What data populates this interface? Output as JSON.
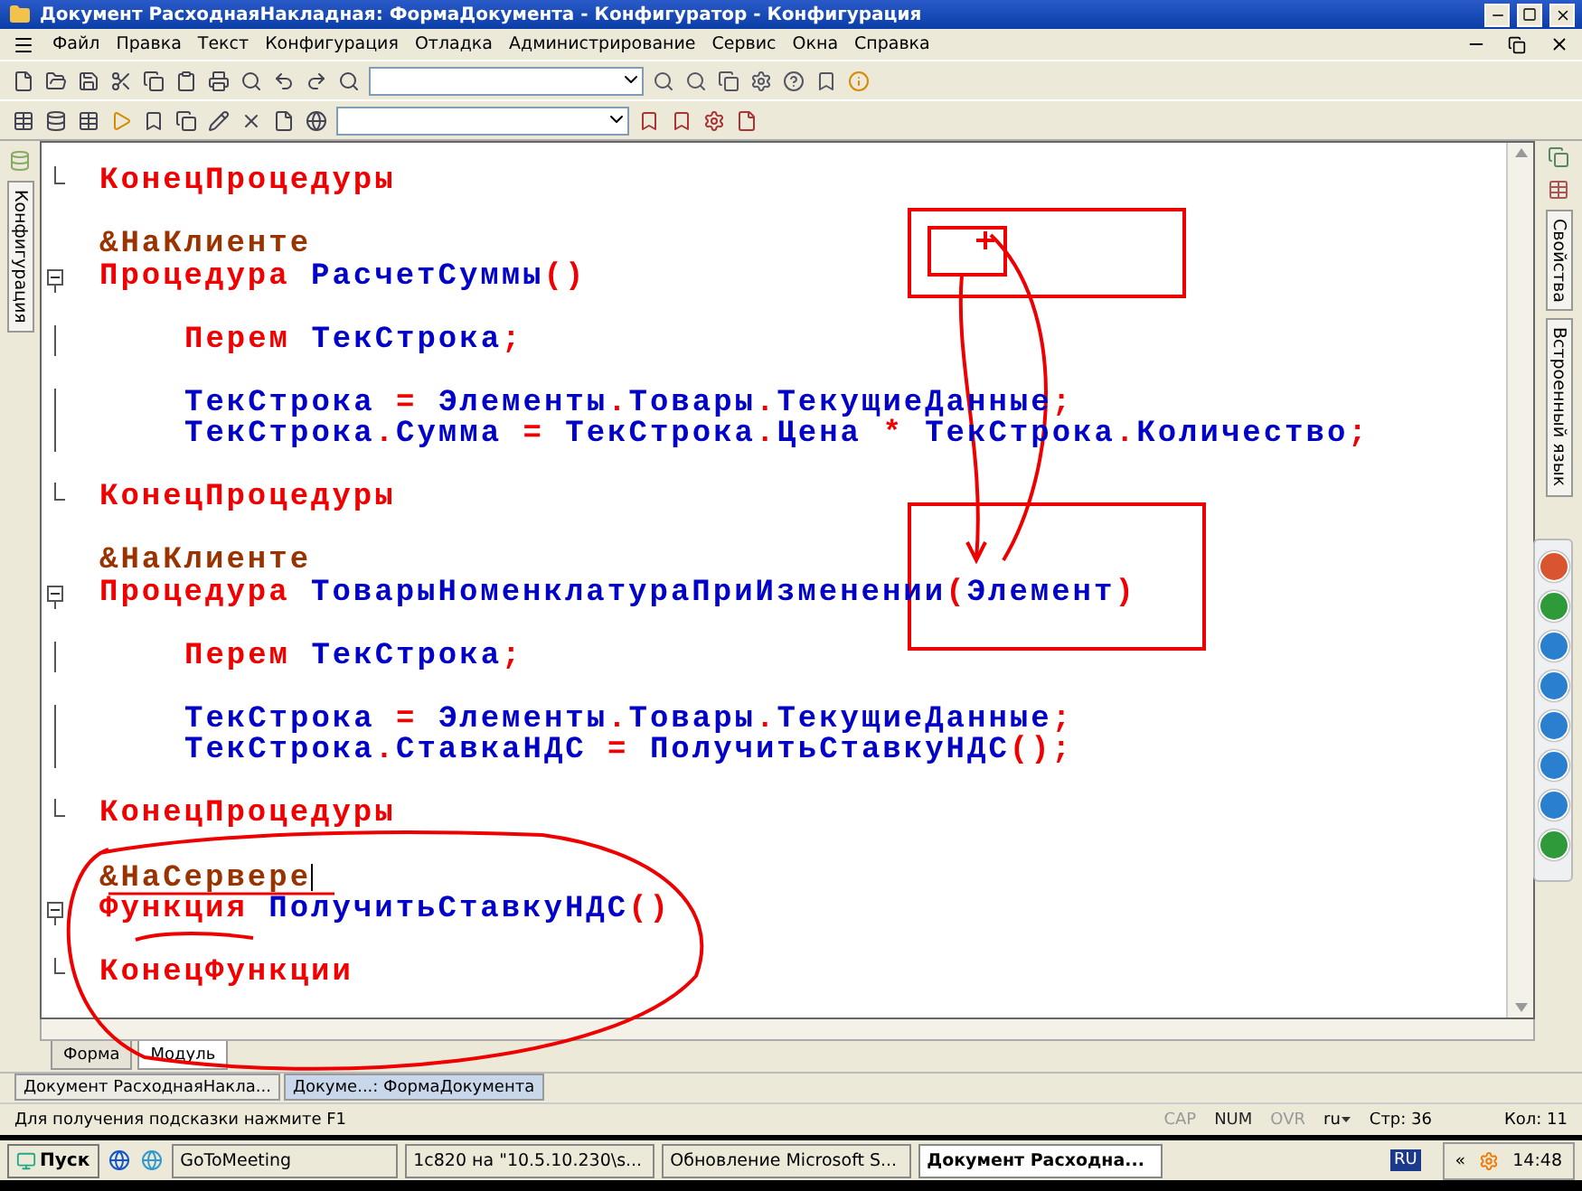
{
  "window": {
    "title": "Документ РасходнаяНакладная: ФормаДокумента - Конфигуратор - Конфигурация"
  },
  "menu": [
    "Файл",
    "Правка",
    "Текст",
    "Конфигурация",
    "Отладка",
    "Администрирование",
    "Сервис",
    "Окна",
    "Справка"
  ],
  "left_panel": {
    "tab": "Конфигурация"
  },
  "right_panel": {
    "tabs": [
      "Свойства",
      "Встроенный язык"
    ]
  },
  "code_lines": [
    {
      "kind": "block_end",
      "tokens": [
        {
          "text": "КонецПроцедуры",
          "kind": "keyword"
        }
      ]
    },
    {
      "kind": "code",
      "space_before": true,
      "tokens": [
        {
          "text": "&НаКлиенте",
          "kind": "directive"
        }
      ]
    },
    {
      "kind": "block_start",
      "tokens": [
        {
          "text": "Процедура ",
          "kind": "keyword"
        },
        {
          "text": "РасчетСуммы",
          "kind": "ident"
        },
        {
          "text": "()",
          "kind": "op"
        }
      ],
      "children": [
        {
          "kind": "code",
          "space_before": true,
          "tokens": [
            {
              "text": "Перем ",
              "kind": "keyword"
            },
            {
              "text": "ТекСтрока",
              "kind": "ident"
            },
            {
              "text": ";",
              "kind": "op"
            }
          ]
        },
        {
          "kind": "code",
          "space_before": true,
          "tokens": [
            {
              "text": "ТекСтрока",
              "kind": "ident"
            },
            {
              "text": " = ",
              "kind": "op"
            },
            {
              "text": "Элементы",
              "kind": "ident"
            },
            {
              "text": ".",
              "kind": "op"
            },
            {
              "text": "Товары",
              "kind": "ident"
            },
            {
              "text": ".",
              "kind": "op"
            },
            {
              "text": "ТекущиеДанные",
              "kind": "ident"
            },
            {
              "text": ";",
              "kind": "op"
            }
          ]
        },
        {
          "kind": "code",
          "tokens": [
            {
              "text": "ТекСтрока",
              "kind": "ident"
            },
            {
              "text": ".",
              "kind": "op"
            },
            {
              "text": "Сумма",
              "kind": "ident"
            },
            {
              "text": " = ",
              "kind": "op"
            },
            {
              "text": "ТекСтрока",
              "kind": "ident"
            },
            {
              "text": ".",
              "kind": "op"
            },
            {
              "text": "Цена",
              "kind": "ident"
            },
            {
              "text": " * ",
              "kind": "op"
            },
            {
              "text": "ТекСтрока",
              "kind": "ident"
            },
            {
              "text": ".",
              "kind": "op"
            },
            {
              "text": "Количество",
              "kind": "ident"
            },
            {
              "text": ";",
              "kind": "op"
            }
          ]
        }
      ]
    },
    {
      "kind": "block_end",
      "space_before": true,
      "tokens": [
        {
          "text": "КонецПроцедуры",
          "kind": "keyword"
        }
      ]
    },
    {
      "kind": "code",
      "space_before": true,
      "tokens": [
        {
          "text": "&НаКлиенте",
          "kind": "directive"
        }
      ]
    },
    {
      "kind": "block_start",
      "tokens": [
        {
          "text": "Процедура ",
          "kind": "keyword"
        },
        {
          "text": "ТоварыНоменклатураПриИзменении",
          "kind": "ident"
        },
        {
          "text": "(",
          "kind": "op"
        },
        {
          "text": "Элемент",
          "kind": "ident"
        },
        {
          "text": ")",
          "kind": "op"
        }
      ],
      "children": [
        {
          "kind": "code",
          "space_before": true,
          "tokens": [
            {
              "text": "Перем ",
              "kind": "keyword"
            },
            {
              "text": "ТекСтрока",
              "kind": "ident"
            },
            {
              "text": ";",
              "kind": "op"
            }
          ]
        },
        {
          "kind": "code",
          "space_before": true,
          "tokens": [
            {
              "text": "ТекСтрока",
              "kind": "ident"
            },
            {
              "text": " = ",
              "kind": "op"
            },
            {
              "text": "Элементы",
              "kind": "ident"
            },
            {
              "text": ".",
              "kind": "op"
            },
            {
              "text": "Товары",
              "kind": "ident"
            },
            {
              "text": ".",
              "kind": "op"
            },
            {
              "text": "ТекущиеДанные",
              "kind": "ident"
            },
            {
              "text": ";",
              "kind": "op"
            }
          ]
        },
        {
          "kind": "code",
          "tokens": [
            {
              "text": "ТекСтрока",
              "kind": "ident"
            },
            {
              "text": ".",
              "kind": "op"
            },
            {
              "text": "СтавкаНДС",
              "kind": "ident"
            },
            {
              "text": " = ",
              "kind": "op"
            },
            {
              "text": "ПолучитьСтавкуНДС",
              "kind": "ident"
            },
            {
              "text": "();",
              "kind": "op"
            }
          ]
        }
      ]
    },
    {
      "kind": "block_end",
      "space_before": true,
      "tokens": [
        {
          "text": "КонецПроцедуры",
          "kind": "keyword"
        }
      ]
    },
    {
      "kind": "code",
      "space_before": true,
      "cursor": true,
      "tokens": [
        {
          "text": "&НаСервере",
          "kind": "directive"
        }
      ]
    },
    {
      "kind": "block_start",
      "tokens": [
        {
          "text": "Функция ",
          "kind": "keyword"
        },
        {
          "text": "ПолучитьСтавкуНДС",
          "kind": "ident"
        },
        {
          "text": "()",
          "kind": "op"
        }
      ]
    },
    {
      "kind": "block_end",
      "space_before": true,
      "tokens": [
        {
          "text": "КонецФункции",
          "kind": "keyword"
        }
      ]
    }
  ],
  "editor_tabs": [
    {
      "label": "Форма",
      "selected": false
    },
    {
      "label": "Модуль",
      "selected": true
    }
  ],
  "window_tabs": [
    {
      "label": "Документ РасходнаяНакла...",
      "selected": false
    },
    {
      "label": "Докуме...: ФормаДокумента",
      "selected": true
    }
  ],
  "status_bar": {
    "hint": "Для получения подсказки нажмите F1",
    "indicators": [
      {
        "label": "CAP",
        "disabled": true
      },
      {
        "label": "NUM",
        "disabled": false
      },
      {
        "label": "OVR",
        "disabled": true
      }
    ],
    "language": "ru",
    "line": "Стр: 36",
    "column": "Кол: 11"
  },
  "taskbar": {
    "start": "Пуск",
    "items": [
      {
        "label": "GoToMeeting",
        "selected": false
      },
      {
        "label": "1с820 на \"10.5.10.230\\s...",
        "selected": false
      },
      {
        "label": "Обновление Microsoft S...",
        "selected": false
      },
      {
        "label": "Документ Расходна...",
        "selected": true
      }
    ],
    "language": "RU",
    "tray_expand": "«",
    "time": "14:48"
  }
}
